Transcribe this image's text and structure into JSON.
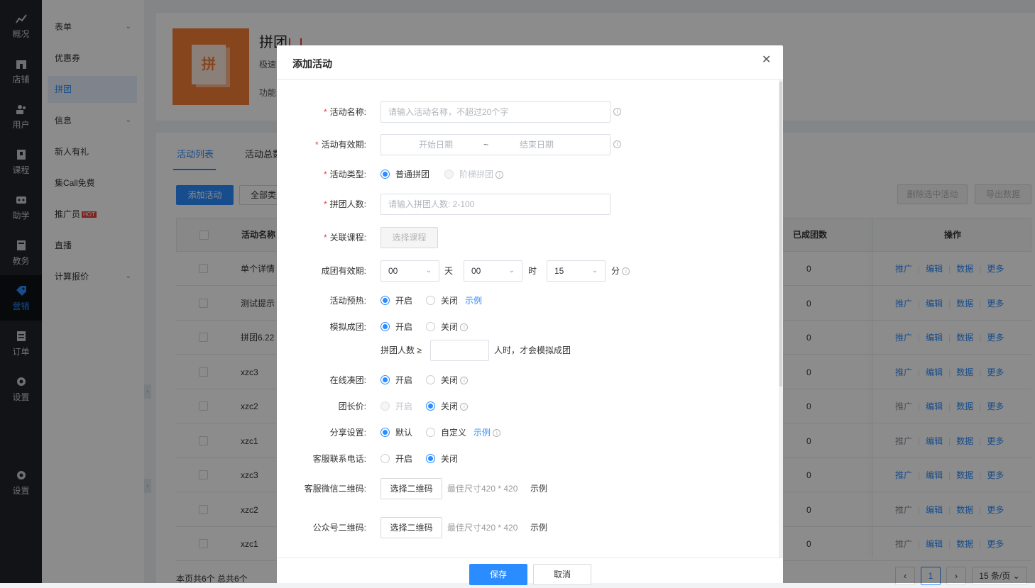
{
  "nav": [
    {
      "label": "概况",
      "icon": "chart-icon"
    },
    {
      "label": "店铺",
      "icon": "store-icon"
    },
    {
      "label": "用户",
      "icon": "users-icon"
    },
    {
      "label": "课程",
      "icon": "course-icon"
    },
    {
      "label": "助学",
      "icon": "study-icon"
    },
    {
      "label": "教务",
      "icon": "academic-icon"
    },
    {
      "label": "营销",
      "icon": "tag-icon"
    },
    {
      "label": "订单",
      "icon": "order-icon"
    },
    {
      "label": "设置",
      "icon": "gear-icon"
    },
    {
      "label": "设置",
      "icon": "gear-icon"
    }
  ],
  "sub_menu": [
    {
      "label": "表单",
      "chevron": true
    },
    {
      "label": "优惠券"
    },
    {
      "label": "拼团",
      "active": true
    },
    {
      "label": "信息",
      "chevron": true
    },
    {
      "label": "新人有礼"
    },
    {
      "label": "集Call免费"
    },
    {
      "label": "推广员",
      "badge": "HOT"
    },
    {
      "label": "直播"
    },
    {
      "label": "计算报价",
      "chevron": true
    }
  ],
  "header": {
    "title": "拼团",
    "thumb_char": "拼",
    "desc_1": "极速",
    "desc_2": "功能"
  },
  "tabs": [
    "活动列表",
    "活动总数"
  ],
  "toolbar": {
    "add": "添加活动",
    "type_filter": "全部类型",
    "delete": "删除选中活动",
    "export": "导出数据"
  },
  "table": {
    "headers": {
      "name": "活动名称",
      "groups": "已成团数",
      "ops": "操作"
    },
    "rows": [
      {
        "name": "单个详情",
        "groups": "0",
        "promo_active": true
      },
      {
        "name": "测试提示",
        "groups": "0",
        "promo_active": true
      },
      {
        "name": "拼团6.22",
        "groups": "0",
        "promo_active": true
      },
      {
        "name": "xzc3",
        "groups": "0",
        "promo_active": true
      },
      {
        "name": "xzc2",
        "groups": "0",
        "promo_active": false
      },
      {
        "name": "xzc1",
        "groups": "0",
        "promo_active": false
      },
      {
        "name": "xzc3",
        "groups": "0",
        "promo_active": true
      },
      {
        "name": "xzc2",
        "groups": "0",
        "promo_active": false
      },
      {
        "name": "xzc1",
        "groups": "0",
        "promo_active": false
      }
    ],
    "op_labels": [
      "推广",
      "编辑",
      "数据",
      "更多"
    ]
  },
  "footer": {
    "summary": "本页共6个 总共6个",
    "current_page": "1",
    "page_size": "15 条/页"
  },
  "modal": {
    "title": "添加活动",
    "name_label": "活动名称:",
    "name_placeholder": "请输入活动名称，不超过20个字",
    "period_label": "活动有效期:",
    "start_placeholder": "开始日期",
    "range_sep": "~",
    "end_placeholder": "结束日期",
    "type_label": "活动类型:",
    "type_normal": "普通拼团",
    "type_tier": "阶梯拼团",
    "size_label": "拼团人数:",
    "size_placeholder": "请输入拼团人数: 2-100",
    "course_label": "关联课程:",
    "course_btn": "选择课程",
    "validity_label": "成团有效期:",
    "days_value": "00",
    "days_unit": "天",
    "hours_value": "00",
    "hours_unit": "时",
    "minutes_value": "15",
    "minutes_unit": "分",
    "preheat_label": "活动预热:",
    "mock_label": "模拟成团:",
    "mock_prefix": "拼团人数 ≥",
    "mock_suffix": "人时，才会模拟成团",
    "online_label": "在线凑团:",
    "leader_label": "团长价:",
    "share_label": "分享设置:",
    "share_default": "默认",
    "share_custom": "自定义",
    "phone_label": "客服联系电话:",
    "wechat_label": "客服微信二维码:",
    "official_label": "公众号二维码:",
    "qr_btn": "选择二维码",
    "qr_hint": "最佳尺寸420 * 420",
    "on": "开启",
    "off": "关闭",
    "example": "示例",
    "save": "保存",
    "cancel": "取消"
  }
}
